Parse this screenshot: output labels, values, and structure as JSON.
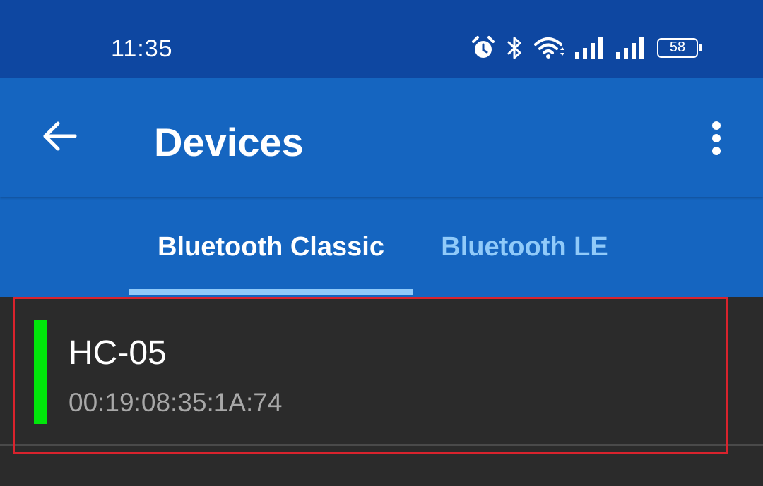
{
  "status_bar": {
    "time": "11:35",
    "battery_level": "58",
    "icons": [
      "alarm-icon",
      "bluetooth-icon",
      "wifi-icon",
      "signal-icon",
      "signal-icon",
      "battery-icon"
    ]
  },
  "app_bar": {
    "title": "Devices",
    "back_icon": "arrow-back-icon",
    "overflow_icon": "more-vert-icon"
  },
  "tabs": [
    {
      "label": "Bluetooth Classic",
      "selected": true
    },
    {
      "label": "Bluetooth LE",
      "selected": false
    }
  ],
  "devices": [
    {
      "name": "HC-05",
      "address": "00:19:08:35:1A:74",
      "connected": true
    }
  ],
  "colors": {
    "status_bar": "#0e47a1",
    "app_bar": "#1565c0",
    "tab_indicator": "#90caf9",
    "connected": "#00e60a",
    "highlight": "#d9232d",
    "list_background": "#2b2b2b"
  }
}
